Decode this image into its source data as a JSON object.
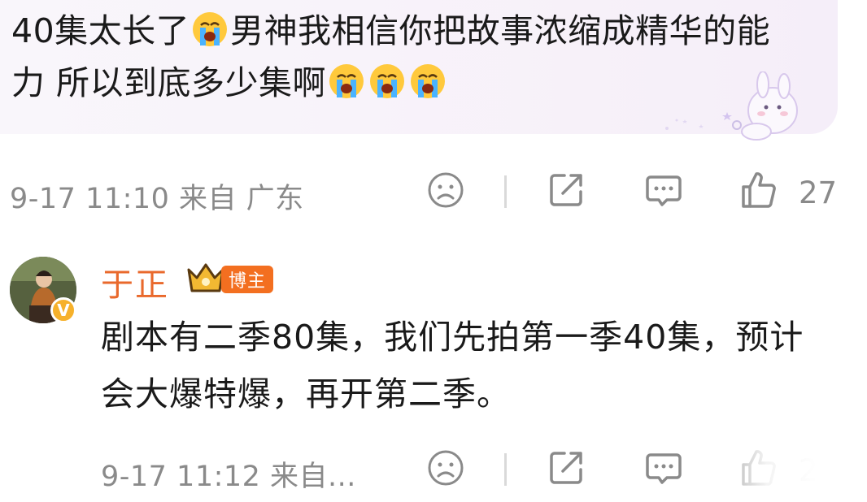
{
  "parent_comment": {
    "text_part1": "40集太长了",
    "text_part2": "男神我相信你把故事浓缩成精华的能力 所以到底多少集啊",
    "emoji_icon": "loudly-crying-face",
    "time": "9-17 11:10 来自 广东",
    "like_count": "27"
  },
  "reply": {
    "username": "于正",
    "badge": "博主",
    "text": "剧本有二季80集，我们先拍第一季40集，预计会大爆特爆，再开第二季。",
    "time": "9-17 11:12 来自...",
    "like_count": "22"
  },
  "icons": {
    "dislike": "sad-face-icon",
    "share": "share-icon",
    "comment": "comment-icon",
    "like": "thumbs-up-icon"
  },
  "colors": {
    "username": "#e9692c",
    "badge_bg": "#f36f20",
    "meta_text": "#8a8a8a",
    "bubble_bg": "#f7f1f9",
    "verified": "#f6b12b"
  }
}
